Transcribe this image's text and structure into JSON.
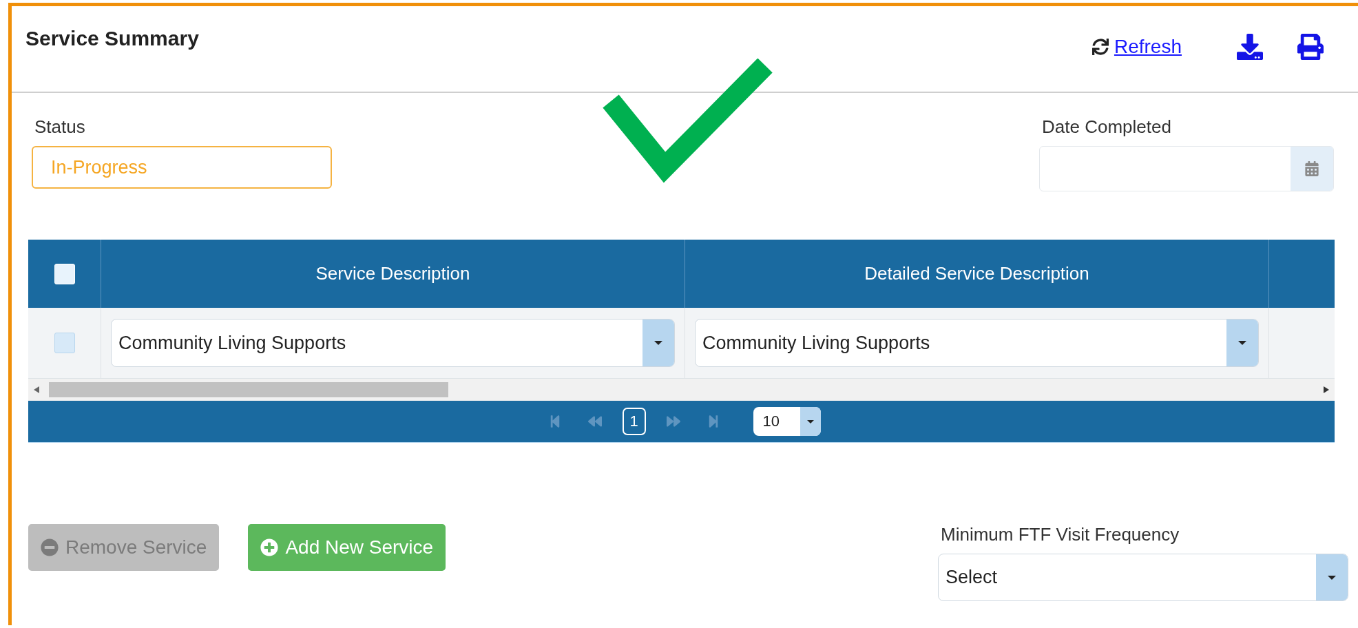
{
  "panel": {
    "title": "Service Summary",
    "refresh_link": "Refresh"
  },
  "status": {
    "label": "Status",
    "value": "In-Progress"
  },
  "date_completed": {
    "label": "Date Completed"
  },
  "table": {
    "select_all_checked": false,
    "columns": [
      "Service Description",
      "Detailed Service Description"
    ],
    "rows": [
      {
        "checked": false,
        "cells": [
          "Community Living Supports",
          "Community Living Supports"
        ]
      }
    ],
    "pager": {
      "page": "1",
      "page_size": "10"
    }
  },
  "buttons": [
    {
      "kind": "remove",
      "label": "Remove Service",
      "disabled": true
    },
    {
      "kind": "add",
      "label": "Add New Service",
      "disabled": false
    }
  ],
  "visit_frequency": {
    "label": "Minimum FTF Visit Frequency",
    "value": "Select"
  }
}
